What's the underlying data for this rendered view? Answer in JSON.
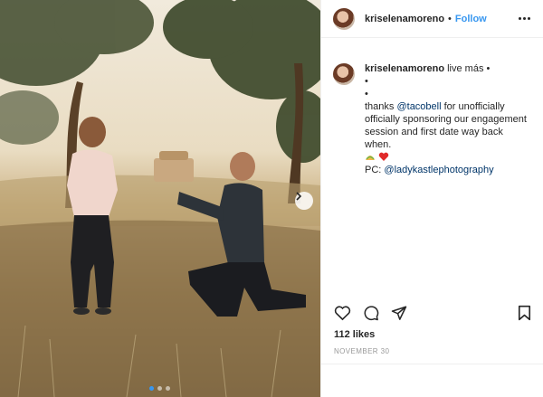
{
  "post": {
    "username": "kriselenamoreno",
    "separator": "•",
    "follow_label": "Follow",
    "caption": {
      "username": "kriselenamoreno",
      "line1": " live más •",
      "bullet_a": "•",
      "bullet_b": "•",
      "text_before_mention": "thanks ",
      "mention1": "@tacobell",
      "text_after_mention": " for unofficially officially sponsoring our engagement session and first date way back when.",
      "emojis": [
        "taco",
        "heart"
      ],
      "credit_prefix": "PC: ",
      "mention2": "@ladykastlephotography"
    },
    "likes": "112 likes",
    "date": "NOVEMBER 30"
  },
  "carousel": {
    "count": 3,
    "active": 0
  },
  "colors": {
    "link_blue": "#3897f0",
    "mention_blue": "#003569",
    "heart_red": "#ed4956"
  },
  "icons": [
    "more-icon",
    "heart-icon",
    "comment-icon",
    "share-icon",
    "bookmark-icon",
    "next-arrow-icon"
  ]
}
